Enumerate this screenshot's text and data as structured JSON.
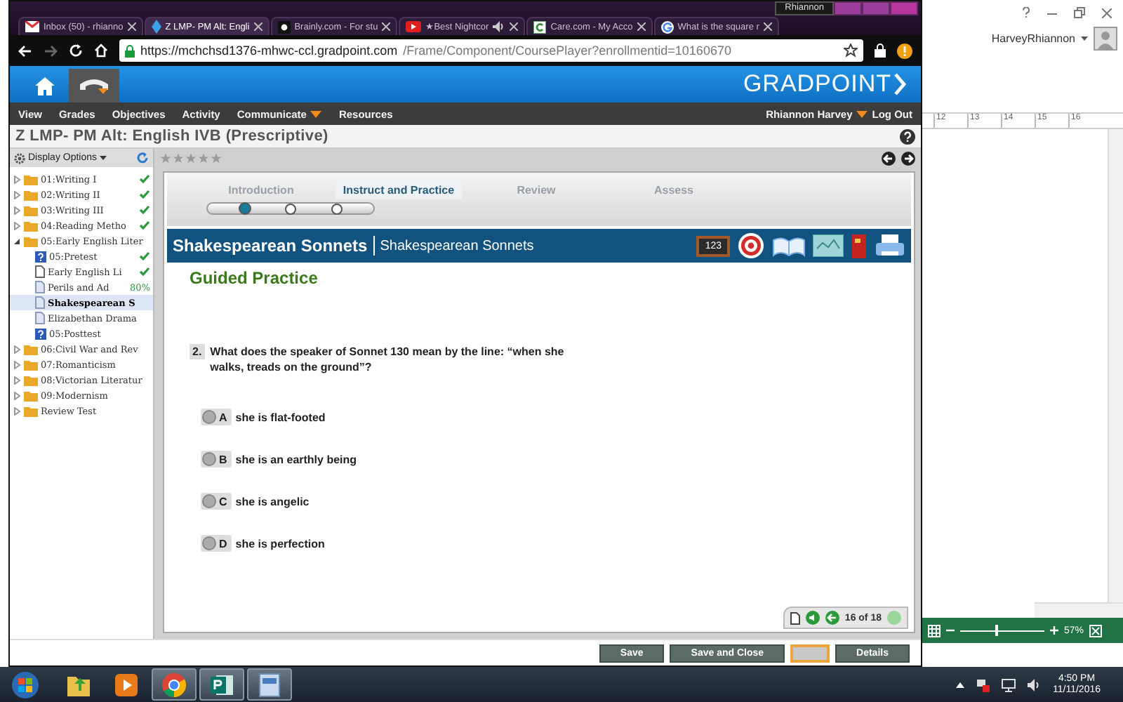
{
  "browser": {
    "profile": "Rhiannon",
    "tabs": [
      {
        "title": "Inbox (50) - rhianno",
        "kind": "mail",
        "selected": false,
        "audio": false
      },
      {
        "title": "Z LMP- PM Alt: Engli",
        "kind": "gradpoint",
        "selected": true,
        "audio": false
      },
      {
        "title": "Brainly.com - For stu",
        "kind": "brainly",
        "selected": false,
        "audio": false
      },
      {
        "title": "★Best Nightcor",
        "kind": "video",
        "selected": false,
        "audio": true
      },
      {
        "title": "Care.com - My Acco",
        "kind": "care",
        "selected": false,
        "audio": false
      },
      {
        "title": "What is the square r",
        "kind": "google",
        "selected": false,
        "audio": false
      }
    ],
    "url": {
      "host": "https://mchchsd1376-mhwc-ccl.gradpoint.com",
      "path": "/Frame/Component/CoursePlayer?enrollmentid=10160670"
    }
  },
  "site": {
    "logo": "GRADPOINT",
    "nav": [
      {
        "label": "View",
        "menu": false
      },
      {
        "label": "Grades",
        "menu": false
      },
      {
        "label": "Objectives",
        "menu": false
      },
      {
        "label": "Activity",
        "menu": false
      },
      {
        "label": "Communicate",
        "menu": true
      },
      {
        "label": "Resources",
        "menu": false
      }
    ],
    "user": "Rhiannon Harvey",
    "logout": "Log Out",
    "course_title": "Z LMP- PM Alt: English IVB (Prescriptive)"
  },
  "sidebar": {
    "display_options": "Display Options",
    "items": [
      {
        "label": "01:Writing I",
        "kind": "folder",
        "complete": true,
        "selected": false,
        "expanded": false
      },
      {
        "label": "02:Writing II",
        "kind": "folder",
        "complete": true,
        "selected": false,
        "expanded": false
      },
      {
        "label": "03:Writing III",
        "kind": "folder",
        "complete": true,
        "selected": false,
        "expanded": false
      },
      {
        "label": "04:Reading Metho",
        "kind": "folder",
        "complete": true,
        "selected": false,
        "expanded": false
      },
      {
        "label": "05:Early English Liter",
        "kind": "folder",
        "complete": false,
        "selected": false,
        "expanded": true,
        "children": [
          {
            "label": "05:Pretest",
            "kind": "quiz",
            "complete": true,
            "selected": false
          },
          {
            "label": "Early English Li",
            "kind": "page",
            "complete": true,
            "selected": false
          },
          {
            "label": "Perils and Ad",
            "kind": "lesson",
            "complete": false,
            "score": "80%",
            "selected": false
          },
          {
            "label": "Shakespearean S",
            "kind": "lesson",
            "complete": false,
            "selected": true
          },
          {
            "label": "Elizabethan Drama",
            "kind": "lesson",
            "complete": false,
            "selected": false
          },
          {
            "label": "05:Posttest",
            "kind": "quiz",
            "complete": false,
            "selected": false
          }
        ]
      },
      {
        "label": "06:Civil War and Rev",
        "kind": "folder",
        "complete": false,
        "selected": false,
        "expanded": false
      },
      {
        "label": "07:Romanticism",
        "kind": "folder",
        "complete": false,
        "selected": false,
        "expanded": false
      },
      {
        "label": "08:Victorian Literatur",
        "kind": "folder",
        "complete": false,
        "selected": false,
        "expanded": false
      },
      {
        "label": "09:Modernism",
        "kind": "folder",
        "complete": false,
        "selected": false,
        "expanded": false
      },
      {
        "label": "Review Test",
        "kind": "folder",
        "complete": false,
        "selected": false,
        "expanded": false
      }
    ]
  },
  "lesson": {
    "rating": {
      "stars": 0
    },
    "phases": [
      {
        "label": "Introduction",
        "selected": false
      },
      {
        "label": "Instruct and Practice",
        "selected": true
      },
      {
        "label": "Review",
        "selected": false
      },
      {
        "label": "Assess",
        "selected": false
      }
    ],
    "steps": [
      {
        "current": true
      },
      {
        "current": false
      },
      {
        "current": false
      }
    ],
    "title": "Shakespearean Sonnets",
    "subtitle": "Shakespearean Sonnets",
    "tools": [
      {
        "kind": "numbers",
        "label": "123"
      },
      {
        "kind": "target"
      },
      {
        "kind": "book"
      },
      {
        "kind": "map"
      },
      {
        "kind": "books"
      },
      {
        "kind": "printer"
      }
    ],
    "section": "Guided Practice",
    "question": {
      "number": "2.",
      "text": "What does the speaker of Sonnet 130 mean by the line: “when she walks, treads on the ground”?",
      "options": [
        {
          "letter": "A",
          "text": "she is flat-footed",
          "selected": false
        },
        {
          "letter": "B",
          "text": "she is an earthly being",
          "selected": false
        },
        {
          "letter": "C",
          "text": "she is angelic",
          "selected": false
        },
        {
          "letter": "D",
          "text": "she is perfection",
          "selected": false
        }
      ]
    },
    "pager": "16 of 18"
  },
  "buttons": [
    {
      "kind": "text",
      "label": "Save"
    },
    {
      "kind": "text",
      "label": "Save and Close"
    },
    {
      "kind": "blank"
    },
    {
      "kind": "text",
      "label": "Details"
    }
  ],
  "office": {
    "user": "HarveyRhiannon",
    "ruler": [
      "12",
      "13",
      "14",
      "15",
      "16"
    ],
    "zoom": {
      "level": 0.42,
      "reading": "57%"
    }
  },
  "taskbar": {
    "apps": [
      {
        "kind": "folder",
        "running": false
      },
      {
        "kind": "media",
        "running": false
      },
      {
        "kind": "chrome",
        "running": true
      },
      {
        "kind": "publisher",
        "running": true
      },
      {
        "kind": "document",
        "running": true
      }
    ],
    "time": "4:50 PM",
    "date": "11/11/2016"
  }
}
